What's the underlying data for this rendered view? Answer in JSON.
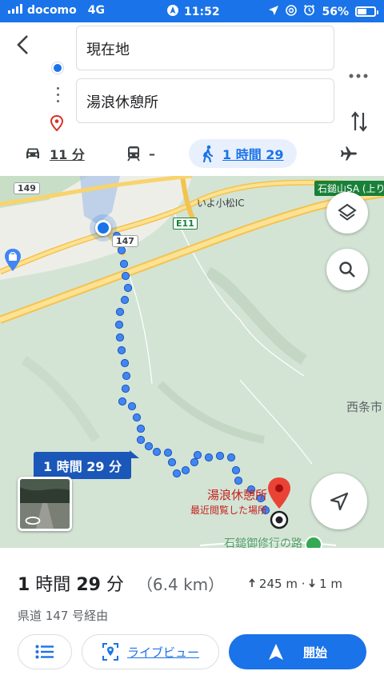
{
  "status_bar": {
    "carrier": "docomo",
    "network": "4G",
    "time": "11:52",
    "battery": "56%",
    "battery_level": 0.56
  },
  "directions": {
    "origin": "現在地",
    "destination": "湯浪休憩所"
  },
  "modes": [
    {
      "name": "drive",
      "label": "11 分"
    },
    {
      "name": "transit",
      "label": "–"
    },
    {
      "name": "walk",
      "label": "1 時間 29",
      "active": true
    },
    {
      "name": "flight",
      "label": ""
    }
  ],
  "map": {
    "route_callout": "1 時間 29 分",
    "labels": {
      "iyo_komatsu_ic": "いよ小松IC",
      "ishizuchi_sa": "石鎚山SA (上り)",
      "saijo_city": "西条市",
      "road_149": "149",
      "road_147": "147",
      "road_e11": "E11",
      "road_below": "石鎚御修行の路"
    },
    "destination_name": "湯浪休憩所",
    "destination_sub": "最近閲覧した場所"
  },
  "summary": {
    "duration_prefix": "1",
    "duration_mid": " 時間 ",
    "duration_minutes": "29",
    "duration_suffix": " 分",
    "distance": "（6.4 km）",
    "ascent": "245 m",
    "descent": "1 m",
    "via": "県道 147 号経由"
  },
  "actions": {
    "steps_label": "",
    "liveview_label": "ライブビュー",
    "start_label": "開始"
  },
  "colors": {
    "accent": "#1a73e8",
    "pin": "#d93025"
  }
}
